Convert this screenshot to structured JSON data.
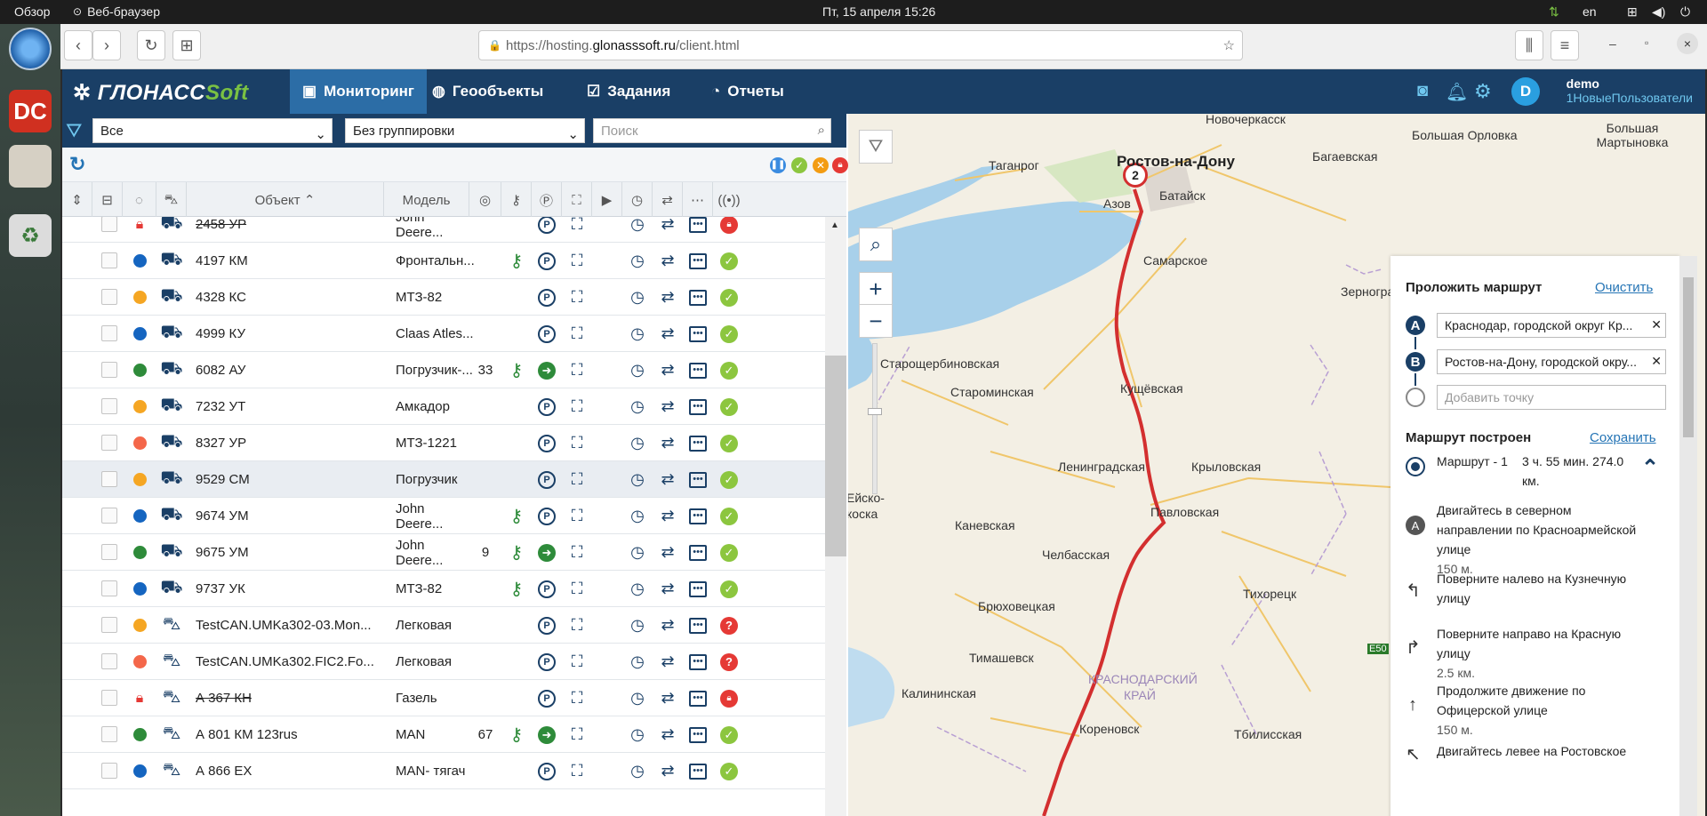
{
  "os": {
    "overview": "Обзор",
    "browser_name": "Веб-браузер",
    "clock": "Пт, 15 апреля  15:26",
    "lang": "en"
  },
  "browser": {
    "url_prefix": "https://hosting.",
    "url_domain": "glonasssoft.ru",
    "url_path": "/client.html"
  },
  "header": {
    "logo_main": "ГЛОНАСС",
    "logo_soft": "Soft",
    "nav": [
      {
        "label": "Мониторинг"
      },
      {
        "label": "Геообъекты"
      },
      {
        "label": "Задания"
      },
      {
        "label": "Отчеты"
      }
    ],
    "user_initial": "D",
    "user_name": "demo",
    "user_group": "1НовыеПользователи"
  },
  "filters": {
    "status": "Все",
    "grouping": "Без группировки",
    "search_placeholder": "Поиск"
  },
  "table": {
    "col_object": "Объект",
    "col_model": "Модель",
    "rows": [
      {
        "name": "2458 УР",
        "model": "John Deere...",
        "speed": "",
        "status": "locked",
        "vehicle": "tractor",
        "strike": true,
        "key": false,
        "drive": false,
        "final": "lock"
      },
      {
        "name": "4197 КМ",
        "model": "Фронтальн...",
        "speed": "",
        "status": "#1565c0",
        "vehicle": "loader",
        "strike": false,
        "key": true,
        "drive": false,
        "final": "ok"
      },
      {
        "name": "4328 КС",
        "model": "МТЗ-82",
        "speed": "",
        "status": "#f5a623",
        "vehicle": "tractor",
        "strike": false,
        "key": false,
        "drive": false,
        "final": "ok"
      },
      {
        "name": "4999 КУ",
        "model": "Claas Atles...",
        "speed": "",
        "status": "#1565c0",
        "vehicle": "tractor",
        "strike": false,
        "key": false,
        "drive": false,
        "final": "ok"
      },
      {
        "name": "6082 АУ",
        "model": "Погрузчик-...",
        "speed": "33",
        "status": "#2e8b3a",
        "vehicle": "loader",
        "strike": false,
        "key": true,
        "drive": true,
        "final": "ok"
      },
      {
        "name": "7232 УТ",
        "model": "Амкадор",
        "speed": "",
        "status": "#f5a623",
        "vehicle": "loader",
        "strike": false,
        "key": false,
        "drive": false,
        "final": "ok"
      },
      {
        "name": "8327 УР",
        "model": "МТЗ-1221",
        "speed": "",
        "status": "#f4674a",
        "vehicle": "tractor",
        "strike": false,
        "key": false,
        "drive": false,
        "final": "ok"
      },
      {
        "name": "9529 СМ",
        "model": "Погрузчик",
        "speed": "",
        "status": "#f5a623",
        "vehicle": "loader",
        "strike": false,
        "key": false,
        "drive": false,
        "final": "ok"
      },
      {
        "name": "9674 УМ",
        "model": "John Deere...",
        "speed": "",
        "status": "#1565c0",
        "vehicle": "tractor",
        "strike": false,
        "key": true,
        "drive": false,
        "final": "ok"
      },
      {
        "name": "9675 УМ",
        "model": "John Deere...",
        "speed": "9",
        "status": "#2e8b3a",
        "vehicle": "tractor",
        "strike": false,
        "key": true,
        "drive": true,
        "final": "ok"
      },
      {
        "name": "9737 УК",
        "model": "МТЗ-82",
        "speed": "",
        "status": "#1565c0",
        "vehicle": "tractor",
        "strike": false,
        "key": true,
        "drive": false,
        "final": "ok"
      },
      {
        "name": "TestCAN.UMKa302-03.Mon...",
        "model": "Легковая",
        "speed": "",
        "status": "#f5a623",
        "vehicle": "car",
        "strike": false,
        "key": false,
        "drive": false,
        "final": "err"
      },
      {
        "name": "TestCAN.UMKa302.FIC2.Fo...",
        "model": "Легковая",
        "speed": "",
        "status": "#f4674a",
        "vehicle": "car",
        "strike": false,
        "key": false,
        "drive": false,
        "final": "err"
      },
      {
        "name": "А 367 КН",
        "model": "Газель",
        "speed": "",
        "status": "locked",
        "vehicle": "van",
        "strike": true,
        "key": false,
        "drive": false,
        "final": "lock"
      },
      {
        "name": "А 801 КМ 123rus",
        "model": "MAN",
        "speed": "67",
        "status": "#2e8b3a",
        "vehicle": "truck",
        "strike": false,
        "key": true,
        "drive": true,
        "final": "ok"
      },
      {
        "name": "А 866 ЕХ",
        "model": "MAN- тягач",
        "speed": "",
        "status": "#1565c0",
        "vehicle": "semi",
        "strike": false,
        "key": false,
        "drive": false,
        "final": "ok"
      }
    ]
  },
  "map": {
    "cluster_count": "2",
    "cities": [
      {
        "name": "Новочеркасск",
        "big": false
      },
      {
        "name": "Большая Орловка",
        "big": false
      },
      {
        "name": "Большая Мартыновка",
        "big": false
      },
      {
        "name": "Таганрог",
        "big": false
      },
      {
        "name": "Ростов-на-Дону",
        "big": true
      },
      {
        "name": "Багаевская",
        "big": false
      },
      {
        "name": "Азов",
        "big": false
      },
      {
        "name": "Батайск",
        "big": false
      },
      {
        "name": "Самарское",
        "big": false
      },
      {
        "name": "Зерноград",
        "big": false
      },
      {
        "name": "Старощербиновская",
        "big": false
      },
      {
        "name": "Староминская",
        "big": false
      },
      {
        "name": "Кущёвская",
        "big": false
      },
      {
        "name": "Ленинградская",
        "big": false
      },
      {
        "name": "Крыловская",
        "big": false
      },
      {
        "name": "Каневская",
        "big": false
      },
      {
        "name": "Павловская",
        "big": false
      },
      {
        "name": "Челбасская",
        "big": false
      },
      {
        "name": "Тихорецк",
        "big": false
      },
      {
        "name": "Брюховецкая",
        "big": false
      },
      {
        "name": "Тимашевск",
        "big": false
      },
      {
        "name": "Калининская",
        "big": false
      },
      {
        "name": "Кореновск",
        "big": false
      },
      {
        "name": "Тбилисская",
        "big": false
      },
      {
        "name": "КРАСНОДАРСКИЙ",
        "big": false
      },
      {
        "name": "КРАЙ",
        "big": false
      },
      {
        "name": "Ейско-",
        "big": false
      },
      {
        "name": "коска",
        "big": false
      },
      {
        "name": "E50",
        "big": false
      }
    ]
  },
  "route": {
    "title": "Проложить маршрут",
    "clear": "Очистить",
    "point_a": "A",
    "point_b": "B",
    "from": "Краснодар, городской округ Кр...",
    "to": "Ростов-на-Дону, городской окру...",
    "add_placeholder": "Добавить точку",
    "built": "Маршрут построен",
    "save": "Сохранить",
    "route_name": "Маршрут - 1",
    "route_info": "3 ч. 55 мин. 274.0 км.",
    "steps": [
      {
        "text": "Двигайтесь в северном направлении по Красноармейской улице",
        "dist": "150 м.",
        "icon": "start"
      },
      {
        "text": "Поверните налево на Кузнечную улицу",
        "dist": "",
        "icon": "left"
      },
      {
        "text": "Поверните направо на Красную улицу",
        "dist": "2.5 км.",
        "icon": "right"
      },
      {
        "text": "Продолжите движение по Офицерской улице",
        "dist": "150 м.",
        "icon": "straight"
      },
      {
        "text": "Двигайтесь левее на Ростовское",
        "dist": "",
        "icon": "left"
      }
    ]
  },
  "colors": {
    "header": "#1a3f66",
    "nav_active": "#2c6da6",
    "accent_green": "#7ac143",
    "ok": "#8cc63f",
    "err": "#e53935",
    "route": "#d32f2f"
  }
}
